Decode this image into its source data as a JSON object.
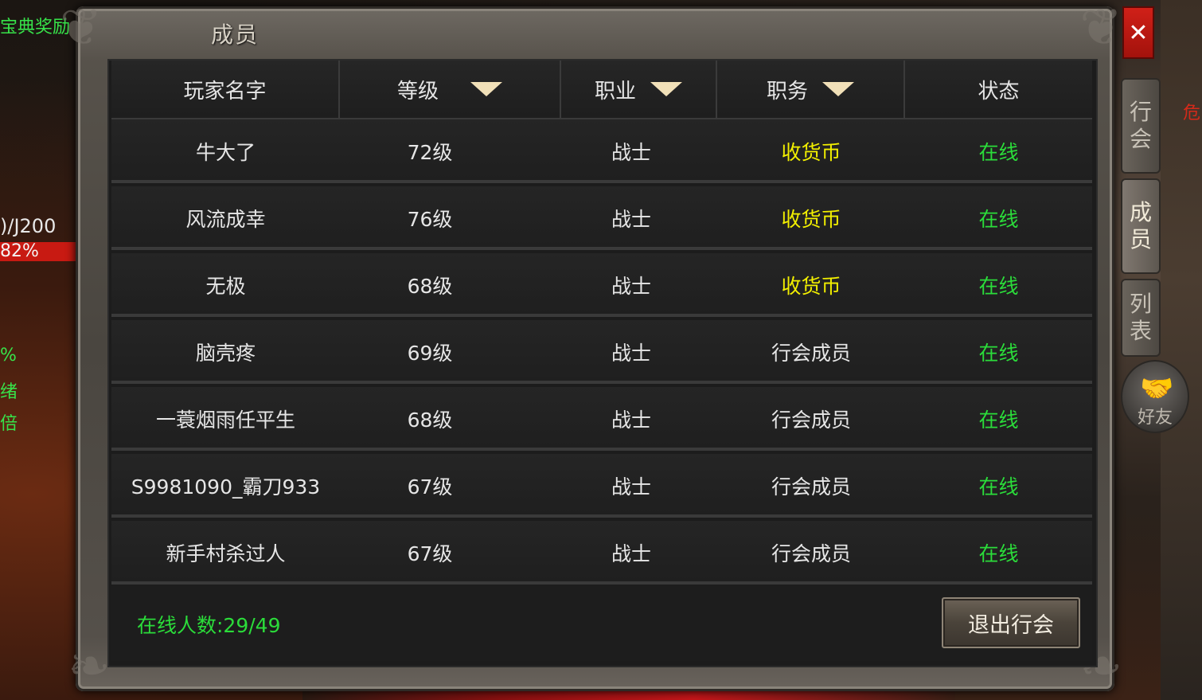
{
  "hud": {
    "line1": "宝典奖励",
    "line2": ")/J200",
    "hp_percent": "82%",
    "line3": "%",
    "line4": "绪",
    "line5": "倍"
  },
  "panel": {
    "title": "成员"
  },
  "table": {
    "headers": {
      "name": "玩家名字",
      "level": "等级",
      "job": "职业",
      "position": "职务",
      "status": "状态"
    },
    "rows": [
      {
        "name": "牛大了",
        "level": "72级",
        "job": "战士",
        "position": "收货币",
        "status": "在线"
      },
      {
        "name": "风流成幸",
        "level": "76级",
        "job": "战士",
        "position": "收货币",
        "status": "在线"
      },
      {
        "name": "无极",
        "level": "68级",
        "job": "战士",
        "position": "收货币",
        "status": "在线"
      },
      {
        "name": "脑壳疼",
        "level": "69级",
        "job": "战士",
        "position": "行会成员",
        "status": "在线"
      },
      {
        "name": "一蓑烟雨任平生",
        "level": "68级",
        "job": "战士",
        "position": "行会成员",
        "status": "在线"
      },
      {
        "name": "S9981090_霸刀933",
        "level": "67级",
        "job": "战士",
        "position": "行会成员",
        "status": "在线"
      },
      {
        "name": "新手村杀过人",
        "level": "67级",
        "job": "战士",
        "position": "行会成员",
        "status": "在线"
      }
    ]
  },
  "footer": {
    "online_count": "在线人数:29/49",
    "leave_button": "退出行会"
  },
  "close_button": "✕",
  "side_tabs": {
    "guild_top": "行",
    "guild_bottom": "会",
    "members_top": "成",
    "members_bottom": "员",
    "list_top": "列",
    "list_bottom": "表",
    "friends": "好友"
  },
  "danger": "危",
  "colors": {
    "position_highlight": "#f3f000",
    "online": "#2bdc3a",
    "close_red": "#d02018"
  }
}
